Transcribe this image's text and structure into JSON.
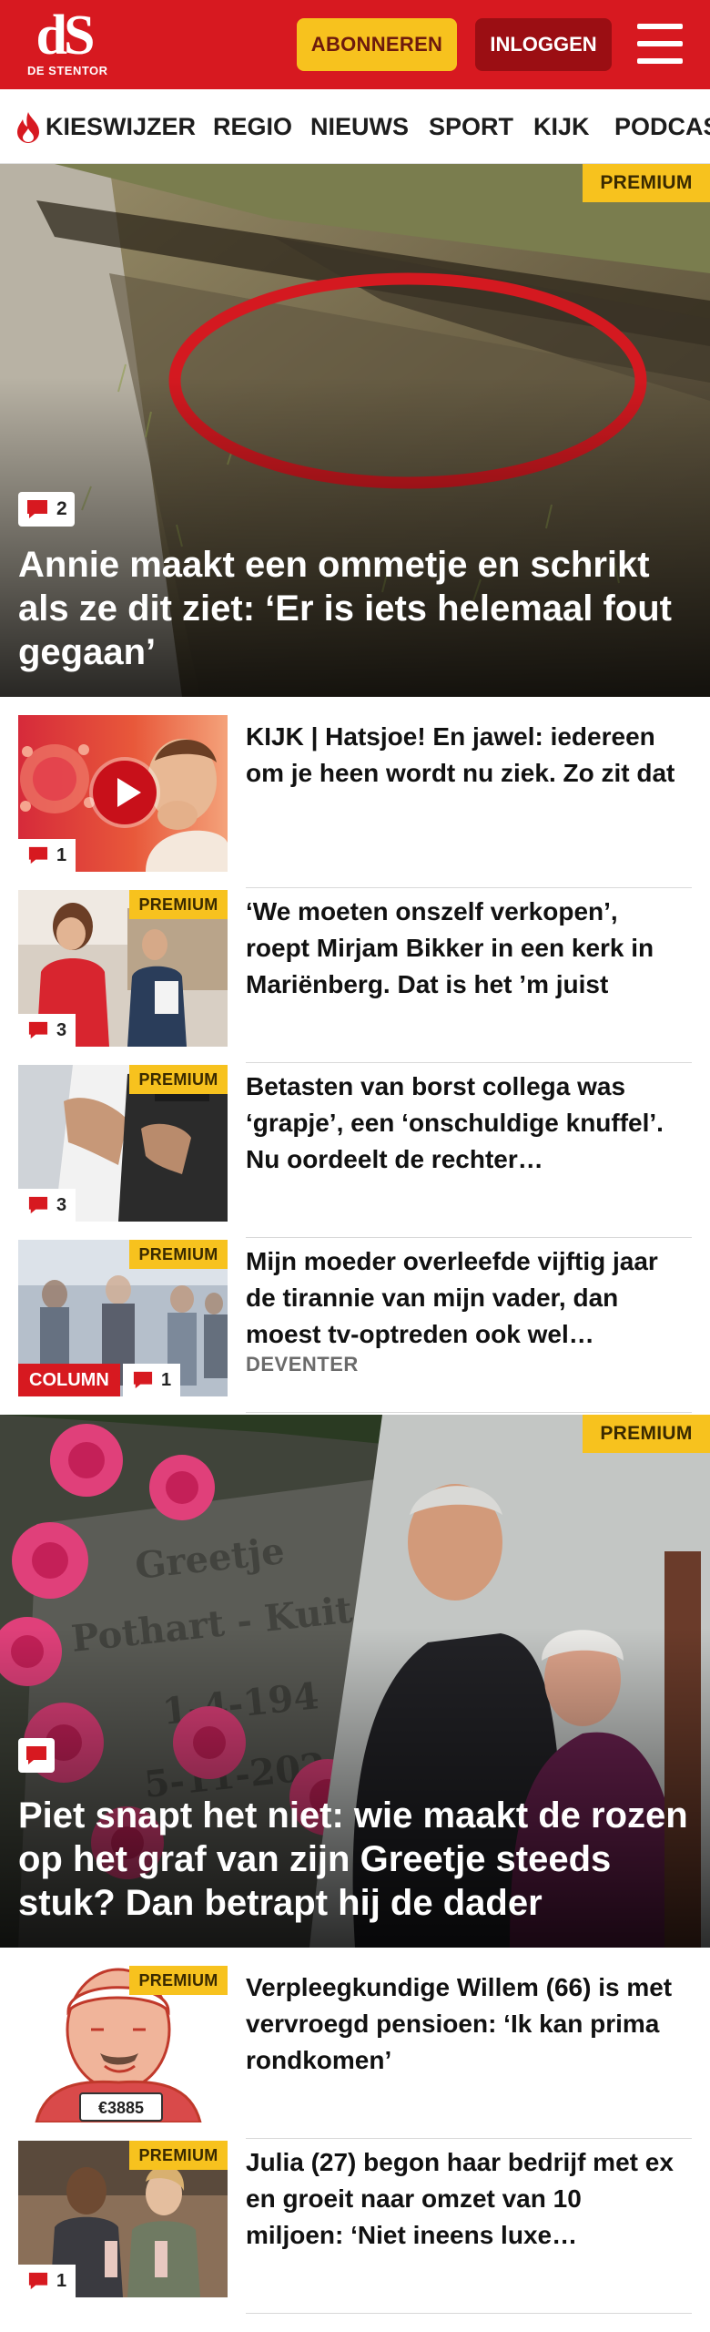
{
  "header": {
    "logo_mark": "dS",
    "logo_sub": "DE STENTOR",
    "subscribe_label": "ABONNEREN",
    "login_label": "INLOGGEN",
    "brand_color": "#d71920",
    "accent_color": "#f7c21e"
  },
  "nav": {
    "items": [
      "KIESWIJZER",
      "REGIO",
      "NIEUWS",
      "SPORT",
      "KIJK",
      "PODCAST"
    ]
  },
  "hero1": {
    "badge": "PREMIUM",
    "comments": "2",
    "title": "Annie maakt een ommetje en schrikt als ze dit ziet: ‘Er is iets helemaal fout gegaan’"
  },
  "articles": [
    {
      "title": "KIJK | Hatsjoe! En jawel: iedereen om je heen wordt nu ziek. Zo zit dat",
      "comments": "1",
      "premium": "",
      "video": true
    },
    {
      "title": "‘We moeten onszelf verkopen’, roept Mirjam Bikker in een kerk in Mariënberg. Dat is het ’m juist",
      "comments": "3",
      "premium": "PREMIUM"
    },
    {
      "title": "Betasten van borst collega was ‘grapje’, een ‘onschuldige knuffel’. Nu oordeelt de rechter…",
      "comments": "3",
      "premium": "PREMIUM"
    },
    {
      "title": "Mijn moeder overleefde vijftig jaar de tirannie van mijn vader, dan moest tv-optreden ook wel…",
      "comments": "1",
      "premium": "PREMIUM",
      "tag": "COLUMN",
      "region": "DEVENTER"
    }
  ],
  "hero2": {
    "badge": "PREMIUM",
    "title": "Piet snapt het niet: wie maakt de rozen op het graf van zijn Greetje steeds stuk? Dan betrapt hij de dader"
  },
  "articles2": [
    {
      "title": "Verpleegkundige Willem (66) is met vervroegd pensioen: ‘Ik kan prima rondkomen’",
      "premium": "PREMIUM",
      "plate": "€3885"
    },
    {
      "title": "Julia (27) begon haar bedrijf met ex en groeit naar omzet van 10 miljoen: ‘Niet ineens luxe…",
      "premium": "PREMIUM",
      "comments": "1"
    }
  ]
}
